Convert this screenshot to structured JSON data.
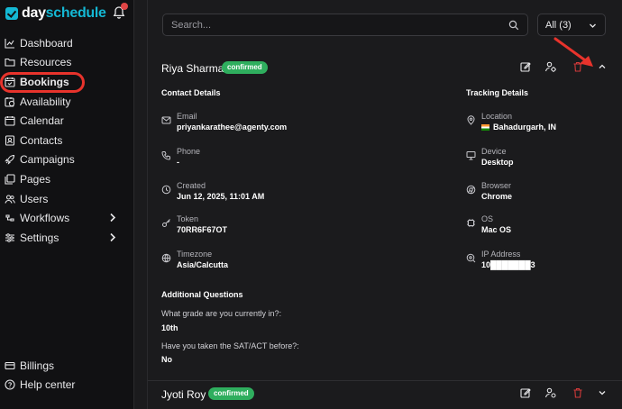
{
  "brand": {
    "name_part1": "day",
    "name_part2": "schedule"
  },
  "sidebar": {
    "items": [
      {
        "label": "Dashboard",
        "icon": "chart-icon"
      },
      {
        "label": "Resources",
        "icon": "folder-icon"
      },
      {
        "label": "Bookings",
        "icon": "calendar-check-icon",
        "active": true
      },
      {
        "label": "Availability",
        "icon": "calendar-clock-icon"
      },
      {
        "label": "Calendar",
        "icon": "calendar-icon"
      },
      {
        "label": "Contacts",
        "icon": "contacts-icon"
      },
      {
        "label": "Campaigns",
        "icon": "rocket-icon"
      },
      {
        "label": "Pages",
        "icon": "pages-icon"
      },
      {
        "label": "Users",
        "icon": "users-icon"
      },
      {
        "label": "Workflows",
        "icon": "workflow-icon",
        "expandable": true
      },
      {
        "label": "Settings",
        "icon": "sliders-icon",
        "expandable": true
      }
    ],
    "bottom": [
      {
        "label": "Billings",
        "icon": "card-icon"
      },
      {
        "label": "Help center",
        "icon": "help-icon"
      }
    ]
  },
  "search": {
    "placeholder": "Search..."
  },
  "filter": {
    "selected": "All (3)"
  },
  "bookings": [
    {
      "name": "Riya Sharma",
      "status": "confirmed",
      "contact_title": "Contact Details",
      "tracking_title": "Tracking Details",
      "contact": [
        {
          "label": "Email",
          "value": "priyankarathee@agenty.com"
        },
        {
          "label": "Phone",
          "value": "-"
        },
        {
          "label": "Created",
          "value": "Jun 12, 2025, 11:01 AM"
        },
        {
          "label": "Token",
          "value": "70RR6F67OT"
        },
        {
          "label": "Timezone",
          "value": "Asia/Calcutta"
        }
      ],
      "tracking": [
        {
          "label": "Location",
          "value": "Bahadurgarh, IN"
        },
        {
          "label": "Device",
          "value": "Desktop"
        },
        {
          "label": "Browser",
          "value": "Chrome"
        },
        {
          "label": "OS",
          "value": "Mac OS"
        },
        {
          "label": "IP Address",
          "value": "10███████3"
        }
      ],
      "questions_title": "Additional Questions",
      "questions": [
        {
          "q": "What grade are you currently in?:",
          "a": "10th"
        },
        {
          "q": "Have you taken the SAT/ACT before?:",
          "a": "No"
        }
      ]
    },
    {
      "name": "Jyoti Roy",
      "status": "confirmed"
    }
  ],
  "colors": {
    "accent": "#14b8d4",
    "badge": "#2fae5e",
    "annotation": "#e8332c",
    "delete": "#d23a3a"
  }
}
